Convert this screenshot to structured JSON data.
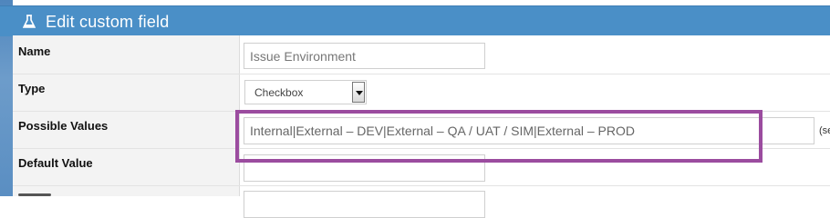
{
  "dialog": {
    "title": "Edit custom field",
    "title_icon": "flask-icon",
    "header_color": "#4a8fc7",
    "highlight_color": "#9b4c9f"
  },
  "fields": {
    "name": {
      "label": "Name",
      "value": "Issue Environment"
    },
    "type": {
      "label": "Type",
      "selected": "Checkbox"
    },
    "possible_values": {
      "label": "Possible Values",
      "value": "Internal|External – DEV|External – QA  / UAT / SIM|External – PROD",
      "hint": "(se"
    },
    "default_value": {
      "label": "Default Value",
      "value": ""
    }
  }
}
